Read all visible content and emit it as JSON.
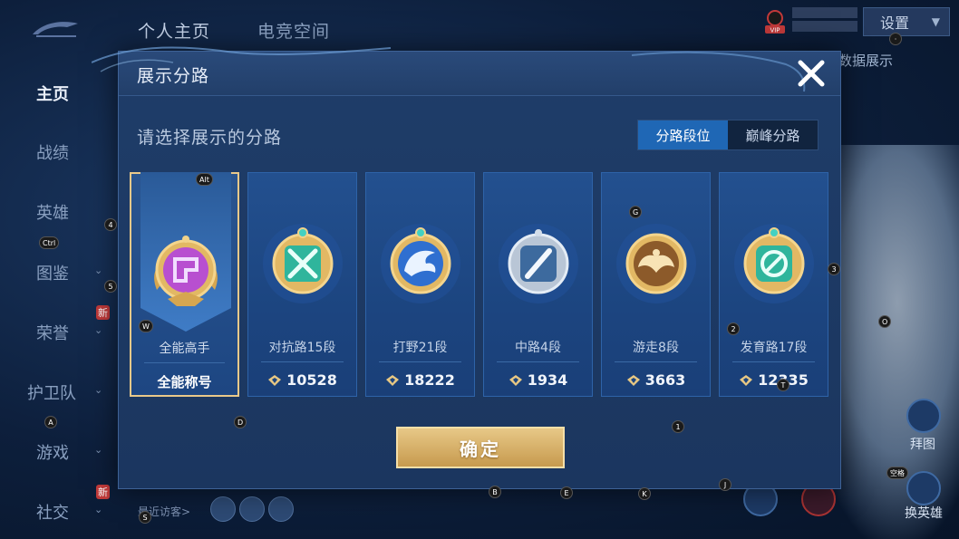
{
  "background": {
    "top_tabs": [
      "个人主页",
      "电竞空间"
    ],
    "sidebar": [
      {
        "label": "主页",
        "active": true,
        "chevron": false,
        "new": false
      },
      {
        "label": "战绩",
        "active": false,
        "chevron": false,
        "new": false
      },
      {
        "label": "英雄",
        "active": false,
        "chevron": false,
        "new": false
      },
      {
        "label": "图鉴",
        "active": false,
        "chevron": true,
        "new": false
      },
      {
        "label": "荣誉",
        "active": false,
        "chevron": true,
        "new": true
      },
      {
        "label": "护卫队",
        "active": false,
        "chevron": true,
        "new": false
      },
      {
        "label": "游戏",
        "active": false,
        "chevron": true,
        "new": false
      },
      {
        "label": "社交",
        "active": false,
        "chevron": true,
        "new": true
      }
    ],
    "new_tag": "新",
    "vip_label": "VIP",
    "settings_label": "设置",
    "hint_text": "和数据展示",
    "recent_visitors": "最近访客>",
    "right_labels": [
      "拜图",
      "换英雄"
    ]
  },
  "modal": {
    "title": "展示分路",
    "prompt": "请选择展示的分路",
    "segments": [
      {
        "label": "分路段位",
        "active": true
      },
      {
        "label": "巅峰分路",
        "active": false
      }
    ],
    "cards": [
      {
        "name": "全能高手",
        "score": "全能称号",
        "selected": true,
        "emblem": "all-round-emblem-icon",
        "color": "#b84fd0"
      },
      {
        "name": "对抗路15段",
        "score": "10528",
        "selected": false,
        "emblem": "clash-lane-emblem-icon",
        "color": "#2fb59c"
      },
      {
        "name": "打野21段",
        "score": "18222",
        "selected": false,
        "emblem": "jungle-emblem-icon",
        "color": "#2f6fd0"
      },
      {
        "name": "中路4段",
        "score": "1934",
        "selected": false,
        "emblem": "mid-lane-emblem-icon",
        "color": "#8fa6c2"
      },
      {
        "name": "游走8段",
        "score": "3663",
        "selected": false,
        "emblem": "roam-emblem-icon",
        "color": "#c99a4f"
      },
      {
        "name": "发育路17段",
        "score": "12335",
        "selected": false,
        "emblem": "farm-lane-emblem-icon",
        "color": "#2fb59c"
      }
    ],
    "confirm_label": "确定"
  },
  "key_hints": [
    "Alt",
    "4",
    "Ctrl",
    "5",
    "W",
    "A",
    "D",
    "G",
    "3",
    "2",
    "O",
    "1",
    "S",
    "B",
    "E",
    "K",
    "J",
    "空格"
  ]
}
